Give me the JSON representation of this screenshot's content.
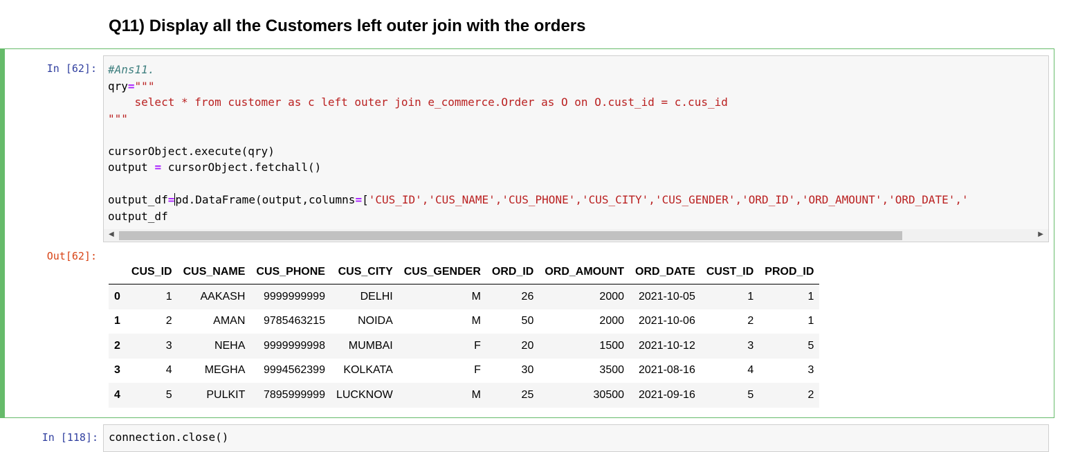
{
  "heading": "Q11) Display all the Customers left outer join with the orders",
  "cell": {
    "in_prompt": "In [62]:",
    "out_prompt": "Out[62]:",
    "code": {
      "l1_comment": "#Ans11.",
      "l2_var": "qry",
      "l2_eq": "=",
      "l2_str": "\"\"\"",
      "l3_str": "    select * from customer as c left outer join e_commerce.Order as O on O.cust_id = c.cus_id",
      "l4_str": "\"\"\"",
      "l6": "cursorObject.execute(qry)",
      "l7_var": "output ",
      "l7_eq": "=",
      "l7_rest": " cursorObject.fetchall()",
      "l9_var": "output_df",
      "l9_eq": "=",
      "l9_mid_a": "p",
      "l9_mid_b": "d.DataFrame(output,columns",
      "l9_eq2": "=",
      "l9_bracket": "[",
      "l9_cols": "'CUS_ID','CUS_NAME','CUS_PHONE','CUS_CITY','CUS_GENDER','ORD_ID','ORD_AMOUNT','ORD_DATE','",
      "l10": "output_df"
    }
  },
  "table": {
    "columns": [
      "",
      "CUS_ID",
      "CUS_NAME",
      "CUS_PHONE",
      "CUS_CITY",
      "CUS_GENDER",
      "ORD_ID",
      "ORD_AMOUNT",
      "ORD_DATE",
      "CUST_ID",
      "PROD_ID"
    ],
    "rows": [
      [
        "0",
        "1",
        "AAKASH",
        "9999999999",
        "DELHI",
        "M",
        "26",
        "2000",
        "2021-10-05",
        "1",
        "1"
      ],
      [
        "1",
        "2",
        "AMAN",
        "9785463215",
        "NOIDA",
        "M",
        "50",
        "2000",
        "2021-10-06",
        "2",
        "1"
      ],
      [
        "2",
        "3",
        "NEHA",
        "9999999998",
        "MUMBAI",
        "F",
        "20",
        "1500",
        "2021-10-12",
        "3",
        "5"
      ],
      [
        "3",
        "4",
        "MEGHA",
        "9994562399",
        "KOLKATA",
        "F",
        "30",
        "3500",
        "2021-08-16",
        "4",
        "3"
      ],
      [
        "4",
        "5",
        "PULKIT",
        "7895999999",
        "LUCKNOW",
        "M",
        "25",
        "30500",
        "2021-09-16",
        "5",
        "2"
      ]
    ]
  },
  "next_cell": {
    "in_prompt": "In [118]:",
    "code": "connection.close()"
  },
  "colors": {
    "selected_border": "#66bb6a",
    "in_prompt": "#303f9f",
    "out_prompt": "#d84315",
    "string": "#ba2121",
    "operator": "#aa22ff",
    "comment": "#408080"
  }
}
